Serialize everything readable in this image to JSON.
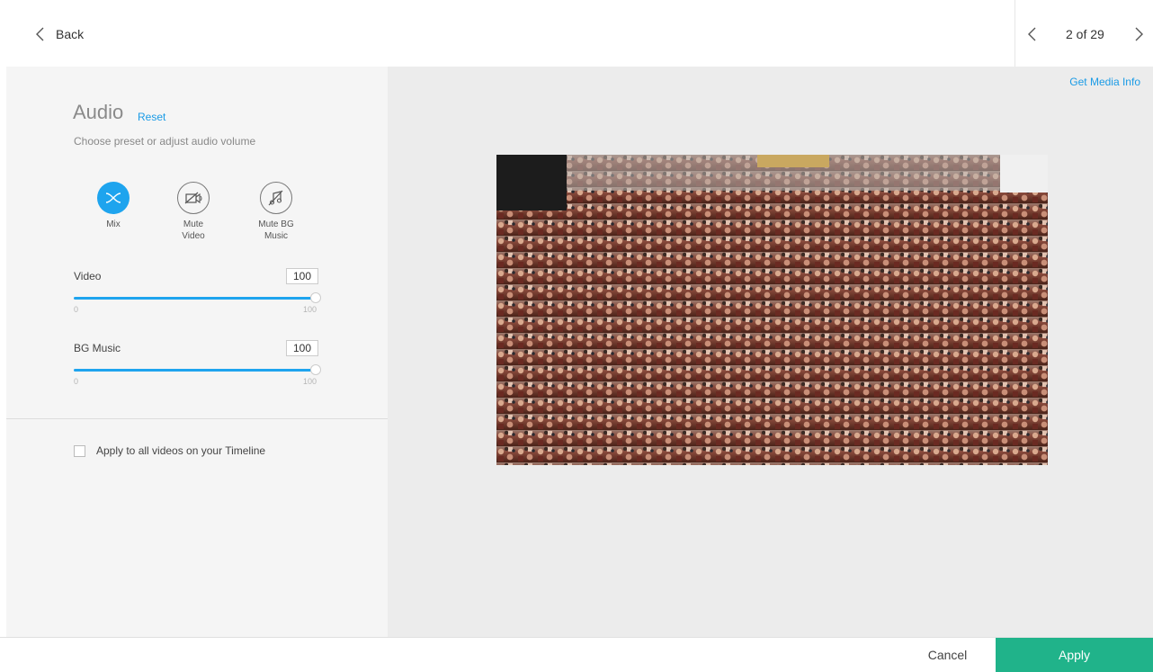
{
  "header": {
    "back_label": "Back",
    "pager": "2 of 29"
  },
  "audio": {
    "title": "Audio",
    "reset_label": "Reset",
    "subtitle": "Choose preset or adjust audio volume",
    "presets": [
      {
        "label": "Mix",
        "icon": "shuffle-icon",
        "active": true
      },
      {
        "label": "Mute\nVideo",
        "icon": "video-muted-icon",
        "active": false
      },
      {
        "label": "Mute BG\nMusic",
        "icon": "music-muted-icon",
        "active": false
      }
    ],
    "sliders": [
      {
        "label": "Video",
        "value": "100",
        "min": "0",
        "max": "100",
        "level": 1.0
      },
      {
        "label": "BG Music",
        "value": "100",
        "min": "0",
        "max": "100",
        "level": 1.0
      }
    ],
    "apply_all_label": "Apply to all videos on your Timeline",
    "apply_all_checked": false
  },
  "preview": {
    "media_info_label": "Get Media Info"
  },
  "footer": {
    "cancel_label": "Cancel",
    "apply_label": "Apply"
  },
  "colors": {
    "accent": "#1ea4ee",
    "apply": "#20b38a",
    "link": "#1a9be6"
  }
}
